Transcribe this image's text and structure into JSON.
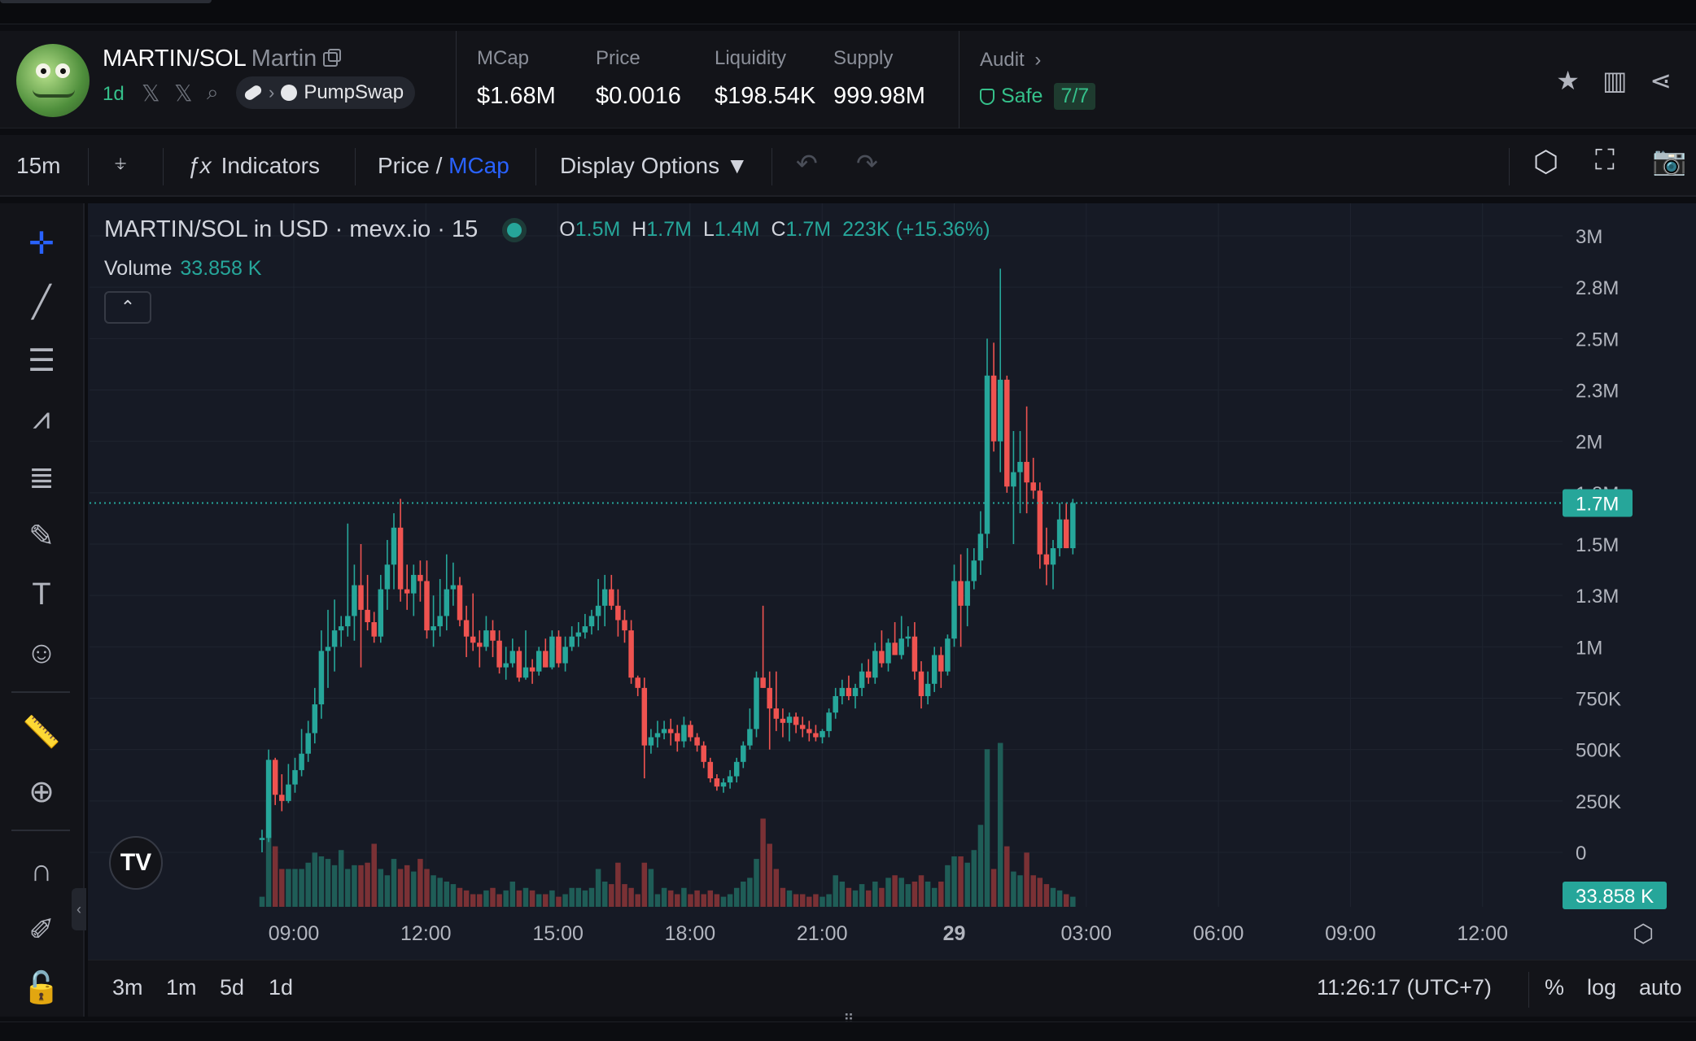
{
  "header": {
    "pair": "MARTIN/SOL",
    "name": "Martin",
    "age": "1d",
    "dex": "PumpSwap",
    "stats": [
      {
        "label": "MCap",
        "value": "$1.68M"
      },
      {
        "label": "Price",
        "value": "$0.0016"
      },
      {
        "label": "Liquidity",
        "value": "$198.54K"
      },
      {
        "label": "Supply",
        "value": "999.98M"
      }
    ],
    "audit": {
      "label": "Audit",
      "status": "Safe",
      "score": "7/7"
    }
  },
  "toolbar": {
    "interval": "15m",
    "indicators": "Indicators",
    "price_label": "Price /",
    "mcap_label": "MCap",
    "display_options": "Display Options ▼"
  },
  "legend": {
    "title": "MARTIN/SOL in USD · mevx.io · 15",
    "o_label": "O",
    "o_value": "1.5M",
    "h_label": "H",
    "h_value": "1.7M",
    "l_label": "L",
    "l_value": "1.4M",
    "c_label": "C",
    "c_value": "1.7M",
    "change": "223K (+15.36%)",
    "volume_label": "Volume",
    "volume_value": "33.858 K"
  },
  "price_axis": {
    "ticks": [
      "3M",
      "2.8M",
      "2.5M",
      "2.3M",
      "2M",
      "1.8M",
      "1.5M",
      "1.3M",
      "1M",
      "750K",
      "500K",
      "250K",
      "0"
    ],
    "current_price_label": "1.7M",
    "current_volume_label": "33.858 K"
  },
  "time_axis": {
    "ticks": [
      "09:00",
      "12:00",
      "15:00",
      "18:00",
      "21:00",
      "29",
      "03:00",
      "06:00",
      "09:00",
      "12:00"
    ]
  },
  "bottom_bar": {
    "ranges": [
      "3m",
      "1m",
      "5d",
      "1d"
    ],
    "clock": "11:26:17 (UTC+7)",
    "percent": "%",
    "log": "log",
    "auto": "auto"
  },
  "colors": {
    "up": "#26a69a",
    "down": "#ef5350",
    "accent": "#2962ff",
    "safe": "#35c08a"
  },
  "chart_data": {
    "type": "candlestick",
    "title": "MARTIN/SOL in USD · mevx.io · 15",
    "interval": "15m",
    "ylim": [
      0,
      3000000
    ],
    "candles": [
      {
        "o": 60000,
        "h": 110000,
        "l": 0,
        "c": 70000,
        "v": 8
      },
      {
        "o": 70000,
        "h": 500000,
        "l": 50000,
        "c": 450000,
        "v": 85
      },
      {
        "o": 450000,
        "h": 460000,
        "l": 230000,
        "c": 280000,
        "v": 48
      },
      {
        "o": 280000,
        "h": 380000,
        "l": 200000,
        "c": 250000,
        "v": 30
      },
      {
        "o": 250000,
        "h": 430000,
        "l": 240000,
        "c": 330000,
        "v": 30
      },
      {
        "o": 330000,
        "h": 460000,
        "l": 290000,
        "c": 400000,
        "v": 30
      },
      {
        "o": 400000,
        "h": 600000,
        "l": 370000,
        "c": 480000,
        "v": 30
      },
      {
        "o": 480000,
        "h": 640000,
        "l": 440000,
        "c": 580000,
        "v": 35
      },
      {
        "o": 580000,
        "h": 800000,
        "l": 530000,
        "c": 720000,
        "v": 43
      },
      {
        "o": 720000,
        "h": 1080000,
        "l": 650000,
        "c": 980000,
        "v": 40
      },
      {
        "o": 980000,
        "h": 1180000,
        "l": 800000,
        "c": 1000000,
        "v": 38
      },
      {
        "o": 1000000,
        "h": 1230000,
        "l": 880000,
        "c": 1080000,
        "v": 33
      },
      {
        "o": 1080000,
        "h": 1150000,
        "l": 1000000,
        "c": 1100000,
        "v": 45
      },
      {
        "o": 1100000,
        "h": 1600000,
        "l": 1050000,
        "c": 1150000,
        "v": 30
      },
      {
        "o": 1150000,
        "h": 1400000,
        "l": 1030000,
        "c": 1300000,
        "v": 33
      },
      {
        "o": 1300000,
        "h": 1500000,
        "l": 900000,
        "c": 1180000,
        "v": 33
      },
      {
        "o": 1180000,
        "h": 1350000,
        "l": 1080000,
        "c": 1120000,
        "v": 35
      },
      {
        "o": 1120000,
        "h": 1170000,
        "l": 1020000,
        "c": 1050000,
        "v": 50
      },
      {
        "o": 1050000,
        "h": 1350000,
        "l": 1020000,
        "c": 1280000,
        "v": 30
      },
      {
        "o": 1280000,
        "h": 1520000,
        "l": 1180000,
        "c": 1400000,
        "v": 25
      },
      {
        "o": 1400000,
        "h": 1650000,
        "l": 1280000,
        "c": 1580000,
        "v": 38
      },
      {
        "o": 1580000,
        "h": 1720000,
        "l": 1220000,
        "c": 1280000,
        "v": 30
      },
      {
        "o": 1280000,
        "h": 1400000,
        "l": 1180000,
        "c": 1260000,
        "v": 33
      },
      {
        "o": 1260000,
        "h": 1400000,
        "l": 1150000,
        "c": 1350000,
        "v": 28
      },
      {
        "o": 1350000,
        "h": 1420000,
        "l": 1220000,
        "c": 1320000,
        "v": 38
      },
      {
        "o": 1320000,
        "h": 1420000,
        "l": 1040000,
        "c": 1080000,
        "v": 30
      },
      {
        "o": 1080000,
        "h": 1250000,
        "l": 1000000,
        "c": 1100000,
        "v": 25
      },
      {
        "o": 1100000,
        "h": 1330000,
        "l": 1050000,
        "c": 1150000,
        "v": 23
      },
      {
        "o": 1150000,
        "h": 1450000,
        "l": 1080000,
        "c": 1280000,
        "v": 20
      },
      {
        "o": 1280000,
        "h": 1410000,
        "l": 1200000,
        "c": 1300000,
        "v": 18
      },
      {
        "o": 1300000,
        "h": 1340000,
        "l": 1100000,
        "c": 1130000,
        "v": 15
      },
      {
        "o": 1130000,
        "h": 1200000,
        "l": 950000,
        "c": 1050000,
        "v": 13
      },
      {
        "o": 1050000,
        "h": 1260000,
        "l": 980000,
        "c": 1020000,
        "v": 10
      },
      {
        "o": 1020000,
        "h": 1080000,
        "l": 900000,
        "c": 1000000,
        "v": 10
      },
      {
        "o": 1000000,
        "h": 1150000,
        "l": 980000,
        "c": 1080000,
        "v": 13
      },
      {
        "o": 1080000,
        "h": 1130000,
        "l": 950000,
        "c": 1030000,
        "v": 15
      },
      {
        "o": 1030000,
        "h": 1080000,
        "l": 870000,
        "c": 900000,
        "v": 10
      },
      {
        "o": 900000,
        "h": 1000000,
        "l": 840000,
        "c": 920000,
        "v": 13
      },
      {
        "o": 920000,
        "h": 1040000,
        "l": 900000,
        "c": 980000,
        "v": 20
      },
      {
        "o": 980000,
        "h": 1000000,
        "l": 830000,
        "c": 850000,
        "v": 13
      },
      {
        "o": 850000,
        "h": 1080000,
        "l": 840000,
        "c": 900000,
        "v": 15
      },
      {
        "o": 900000,
        "h": 940000,
        "l": 820000,
        "c": 880000,
        "v": 13
      },
      {
        "o": 880000,
        "h": 1000000,
        "l": 860000,
        "c": 980000,
        "v": 10
      },
      {
        "o": 980000,
        "h": 1040000,
        "l": 900000,
        "c": 900000,
        "v": 10
      },
      {
        "o": 900000,
        "h": 1080000,
        "l": 890000,
        "c": 1050000,
        "v": 13
      },
      {
        "o": 1050000,
        "h": 1080000,
        "l": 900000,
        "c": 920000,
        "v": 8
      },
      {
        "o": 920000,
        "h": 1050000,
        "l": 880000,
        "c": 1000000,
        "v": 10
      },
      {
        "o": 1000000,
        "h": 1100000,
        "l": 980000,
        "c": 1050000,
        "v": 15
      },
      {
        "o": 1050000,
        "h": 1120000,
        "l": 1000000,
        "c": 1070000,
        "v": 15
      },
      {
        "o": 1070000,
        "h": 1160000,
        "l": 1040000,
        "c": 1100000,
        "v": 13
      },
      {
        "o": 1100000,
        "h": 1180000,
        "l": 1060000,
        "c": 1150000,
        "v": 15
      },
      {
        "o": 1150000,
        "h": 1330000,
        "l": 1080000,
        "c": 1200000,
        "v": 30
      },
      {
        "o": 1200000,
        "h": 1350000,
        "l": 1100000,
        "c": 1280000,
        "v": 20
      },
      {
        "o": 1280000,
        "h": 1350000,
        "l": 1180000,
        "c": 1200000,
        "v": 18
      },
      {
        "o": 1200000,
        "h": 1280000,
        "l": 1050000,
        "c": 1130000,
        "v": 35
      },
      {
        "o": 1130000,
        "h": 1180000,
        "l": 1020000,
        "c": 1080000,
        "v": 18
      },
      {
        "o": 1080000,
        "h": 1130000,
        "l": 820000,
        "c": 850000,
        "v": 15
      },
      {
        "o": 850000,
        "h": 860000,
        "l": 760000,
        "c": 800000,
        "v": 10
      },
      {
        "o": 800000,
        "h": 850000,
        "l": 360000,
        "c": 520000,
        "v": 35
      },
      {
        "o": 520000,
        "h": 600000,
        "l": 480000,
        "c": 560000,
        "v": 30
      },
      {
        "o": 560000,
        "h": 640000,
        "l": 510000,
        "c": 580000,
        "v": 10
      },
      {
        "o": 580000,
        "h": 640000,
        "l": 550000,
        "c": 600000,
        "v": 15
      },
      {
        "o": 600000,
        "h": 650000,
        "l": 520000,
        "c": 580000,
        "v": 13
      },
      {
        "o": 580000,
        "h": 620000,
        "l": 490000,
        "c": 540000,
        "v": 10
      },
      {
        "o": 540000,
        "h": 660000,
        "l": 510000,
        "c": 620000,
        "v": 15
      },
      {
        "o": 620000,
        "h": 640000,
        "l": 540000,
        "c": 560000,
        "v": 10
      },
      {
        "o": 560000,
        "h": 580000,
        "l": 490000,
        "c": 520000,
        "v": 13
      },
      {
        "o": 520000,
        "h": 540000,
        "l": 410000,
        "c": 440000,
        "v": 10
      },
      {
        "o": 440000,
        "h": 460000,
        "l": 340000,
        "c": 360000,
        "v": 13
      },
      {
        "o": 360000,
        "h": 380000,
        "l": 300000,
        "c": 320000,
        "v": 10
      },
      {
        "o": 320000,
        "h": 360000,
        "l": 290000,
        "c": 340000,
        "v": 8
      },
      {
        "o": 340000,
        "h": 400000,
        "l": 310000,
        "c": 370000,
        "v": 10
      },
      {
        "o": 370000,
        "h": 460000,
        "l": 340000,
        "c": 440000,
        "v": 15
      },
      {
        "o": 440000,
        "h": 540000,
        "l": 410000,
        "c": 520000,
        "v": 20
      },
      {
        "o": 520000,
        "h": 700000,
        "l": 500000,
        "c": 600000,
        "v": 23
      },
      {
        "o": 600000,
        "h": 880000,
        "l": 560000,
        "c": 850000,
        "v": 38
      },
      {
        "o": 850000,
        "h": 1200000,
        "l": 800000,
        "c": 800000,
        "v": 70
      },
      {
        "o": 800000,
        "h": 880000,
        "l": 500000,
        "c": 700000,
        "v": 50
      },
      {
        "o": 700000,
        "h": 880000,
        "l": 590000,
        "c": 650000,
        "v": 30
      },
      {
        "o": 650000,
        "h": 700000,
        "l": 560000,
        "c": 630000,
        "v": 15
      },
      {
        "o": 630000,
        "h": 680000,
        "l": 540000,
        "c": 660000,
        "v": 13
      },
      {
        "o": 660000,
        "h": 680000,
        "l": 580000,
        "c": 620000,
        "v": 10
      },
      {
        "o": 620000,
        "h": 660000,
        "l": 560000,
        "c": 600000,
        "v": 10
      },
      {
        "o": 600000,
        "h": 640000,
        "l": 540000,
        "c": 580000,
        "v": 8
      },
      {
        "o": 580000,
        "h": 620000,
        "l": 540000,
        "c": 560000,
        "v": 10
      },
      {
        "o": 560000,
        "h": 600000,
        "l": 530000,
        "c": 590000,
        "v": 8
      },
      {
        "o": 590000,
        "h": 700000,
        "l": 560000,
        "c": 680000,
        "v": 10
      },
      {
        "o": 680000,
        "h": 800000,
        "l": 650000,
        "c": 760000,
        "v": 25
      },
      {
        "o": 760000,
        "h": 840000,
        "l": 720000,
        "c": 800000,
        "v": 20
      },
      {
        "o": 800000,
        "h": 860000,
        "l": 740000,
        "c": 760000,
        "v": 15
      },
      {
        "o": 760000,
        "h": 820000,
        "l": 700000,
        "c": 800000,
        "v": 13
      },
      {
        "o": 800000,
        "h": 920000,
        "l": 760000,
        "c": 880000,
        "v": 18
      },
      {
        "o": 880000,
        "h": 940000,
        "l": 820000,
        "c": 850000,
        "v": 13
      },
      {
        "o": 850000,
        "h": 1020000,
        "l": 820000,
        "c": 980000,
        "v": 20
      },
      {
        "o": 980000,
        "h": 1080000,
        "l": 900000,
        "c": 920000,
        "v": 15
      },
      {
        "o": 920000,
        "h": 1040000,
        "l": 880000,
        "c": 1020000,
        "v": 23
      },
      {
        "o": 1020000,
        "h": 1120000,
        "l": 960000,
        "c": 960000,
        "v": 25
      },
      {
        "o": 960000,
        "h": 1150000,
        "l": 940000,
        "c": 1040000,
        "v": 23
      },
      {
        "o": 1040000,
        "h": 1100000,
        "l": 1000000,
        "c": 1050000,
        "v": 18
      },
      {
        "o": 1050000,
        "h": 1120000,
        "l": 840000,
        "c": 880000,
        "v": 20
      },
      {
        "o": 880000,
        "h": 930000,
        "l": 700000,
        "c": 760000,
        "v": 25
      },
      {
        "o": 760000,
        "h": 880000,
        "l": 720000,
        "c": 820000,
        "v": 20
      },
      {
        "o": 820000,
        "h": 1000000,
        "l": 780000,
        "c": 960000,
        "v": 15
      },
      {
        "o": 960000,
        "h": 1000000,
        "l": 800000,
        "c": 880000,
        "v": 20
      },
      {
        "o": 880000,
        "h": 1060000,
        "l": 860000,
        "c": 1040000,
        "v": 33
      },
      {
        "o": 1040000,
        "h": 1400000,
        "l": 1000000,
        "c": 1320000,
        "v": 40
      },
      {
        "o": 1320000,
        "h": 1450000,
        "l": 1000000,
        "c": 1200000,
        "v": 40
      },
      {
        "o": 1200000,
        "h": 1480000,
        "l": 1100000,
        "c": 1320000,
        "v": 35
      },
      {
        "o": 1320000,
        "h": 1480000,
        "l": 1280000,
        "c": 1420000,
        "v": 45
      },
      {
        "o": 1420000,
        "h": 1660000,
        "l": 1350000,
        "c": 1550000,
        "v": 65
      },
      {
        "o": 1550000,
        "h": 2500000,
        "l": 1480000,
        "c": 2320000,
        "v": 125
      },
      {
        "o": 2320000,
        "h": 2480000,
        "l": 1950000,
        "c": 2000000,
        "v": 30
      },
      {
        "o": 2000000,
        "h": 2840000,
        "l": 1850000,
        "c": 2300000,
        "v": 130
      },
      {
        "o": 2300000,
        "h": 2320000,
        "l": 1750000,
        "c": 1780000,
        "v": 48
      },
      {
        "o": 1780000,
        "h": 2050000,
        "l": 1500000,
        "c": 1850000,
        "v": 28
      },
      {
        "o": 1850000,
        "h": 2050000,
        "l": 1650000,
        "c": 1900000,
        "v": 25
      },
      {
        "o": 1900000,
        "h": 2170000,
        "l": 1650000,
        "c": 1800000,
        "v": 43
      },
      {
        "o": 1800000,
        "h": 1920000,
        "l": 1720000,
        "c": 1760000,
        "v": 25
      },
      {
        "o": 1760000,
        "h": 1800000,
        "l": 1380000,
        "c": 1450000,
        "v": 23
      },
      {
        "o": 1450000,
        "h": 1580000,
        "l": 1300000,
        "c": 1400000,
        "v": 18
      },
      {
        "o": 1400000,
        "h": 1520000,
        "l": 1280000,
        "c": 1480000,
        "v": 15
      },
      {
        "o": 1480000,
        "h": 1700000,
        "l": 1440000,
        "c": 1620000,
        "v": 13
      },
      {
        "o": 1620000,
        "h": 1700000,
        "l": 1480000,
        "c": 1480000,
        "v": 10
      },
      {
        "o": 1480000,
        "h": 1720000,
        "l": 1450000,
        "c": 1700000,
        "v": 8
      }
    ]
  }
}
